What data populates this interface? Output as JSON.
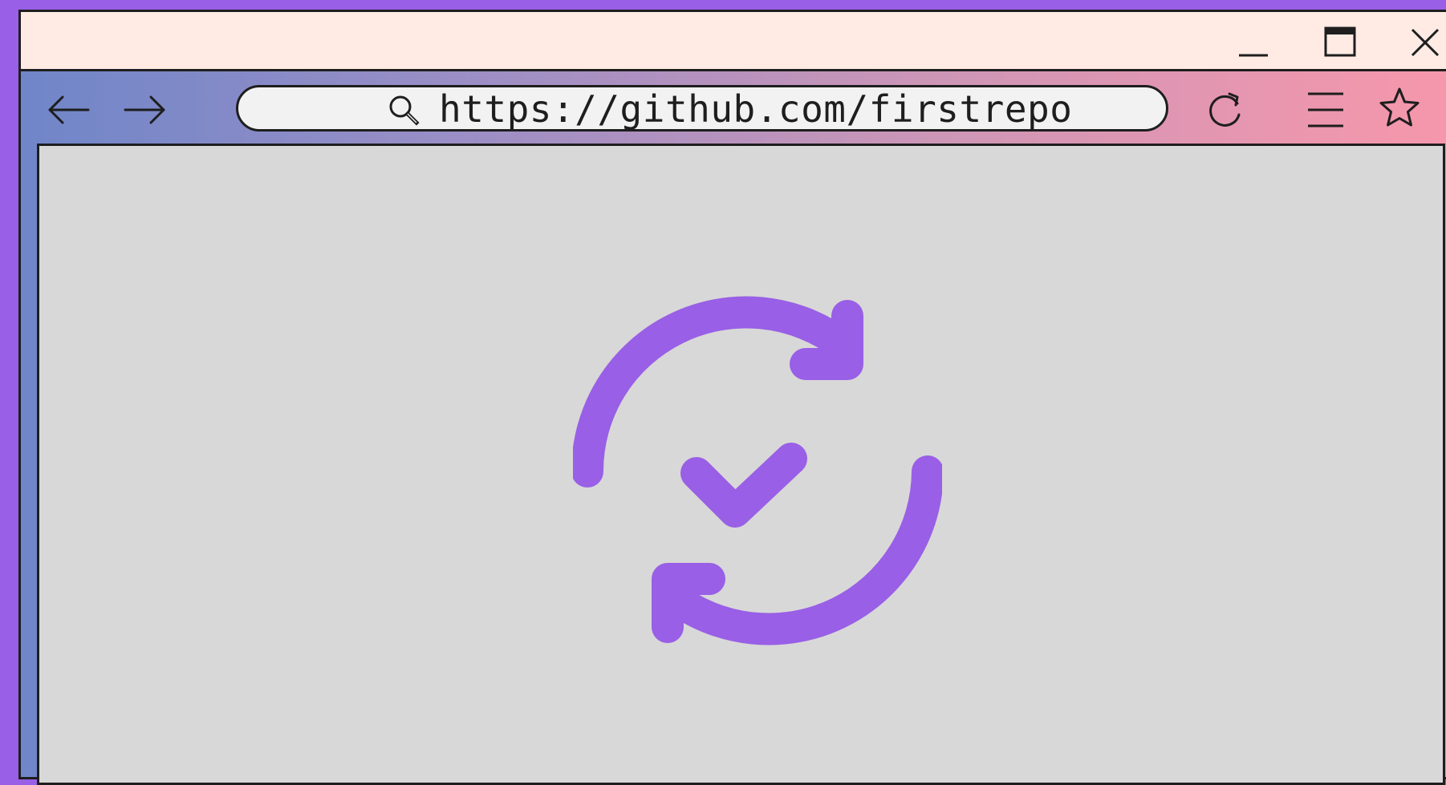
{
  "window": {
    "buttons": {
      "minimize_icon": "minimize-icon",
      "maximize_icon": "maximize-icon",
      "close_icon": "close-icon"
    }
  },
  "toolbar": {
    "back_icon": "arrow-left-icon",
    "forward_icon": "arrow-right-icon",
    "address": {
      "url": "https://github.com/firstrepo",
      "icon": "search-icon"
    },
    "reload_icon": "reload-icon",
    "menu_icon": "hamburger-menu-icon",
    "bookmark_icon": "star-icon"
  },
  "content": {
    "icon": "sync-check-icon",
    "icon_color": "#995fe6"
  },
  "colors": {
    "frame": "#995fe6",
    "titlebar": "#ffebe4",
    "toolbar_gradient_start": "#6f86c8",
    "toolbar_gradient_end": "#f797ab",
    "viewport_bg": "#d8d8d8",
    "address_bg": "#f2f2f2",
    "stroke": "#1e1e1e"
  }
}
